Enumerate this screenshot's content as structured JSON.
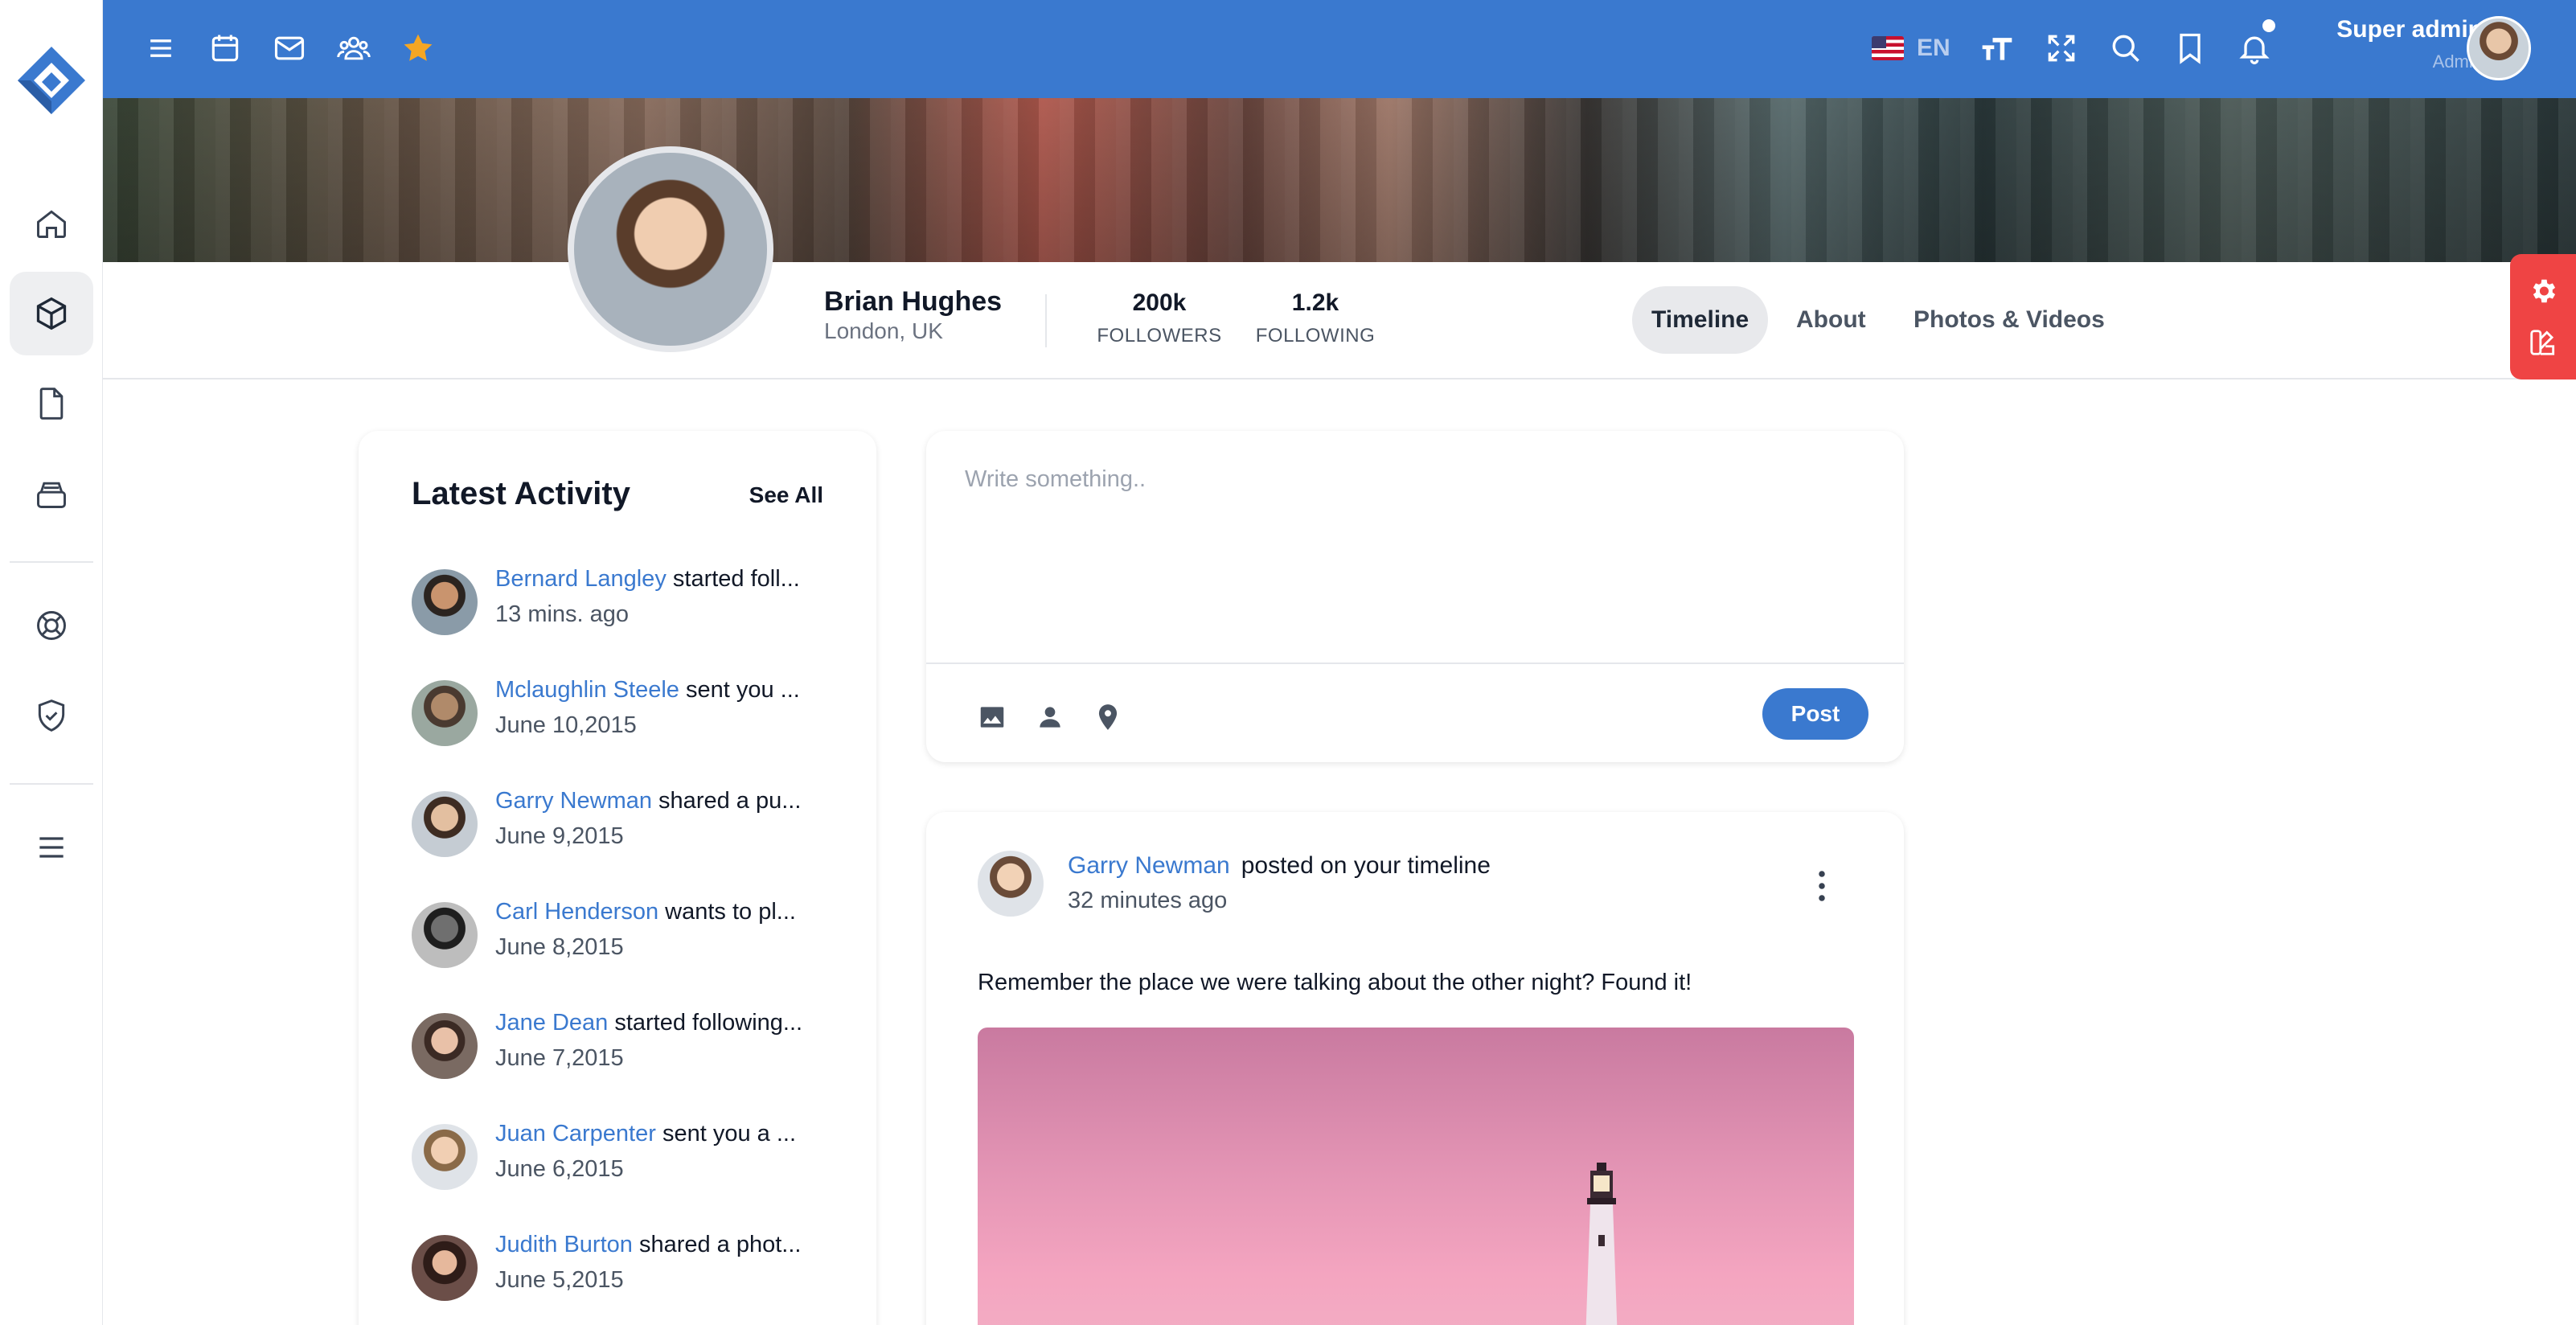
{
  "topbar": {
    "language": "EN",
    "user": {
      "name": "Super admin",
      "role": "Admin"
    }
  },
  "profile": {
    "name": "Brian Hughes",
    "location": "London, UK",
    "stats": [
      {
        "value": "200k",
        "label": "FOLLOWERS"
      },
      {
        "value": "1.2k",
        "label": "FOLLOWING"
      }
    ],
    "tabs": [
      {
        "label": "Timeline",
        "active": true
      },
      {
        "label": "About",
        "active": false
      },
      {
        "label": "Photos & Videos",
        "active": false
      }
    ]
  },
  "activity": {
    "title": "Latest Activity",
    "see_all": "See All",
    "items": [
      {
        "who": "Bernard Langley",
        "action": " started foll...",
        "time": "13 mins. ago"
      },
      {
        "who": "Mclaughlin Steele",
        "action": " sent you ...",
        "time": "June 10,2015"
      },
      {
        "who": "Garry Newman",
        "action": " shared a pu...",
        "time": "June 9,2015"
      },
      {
        "who": "Carl Henderson",
        "action": " wants to pl...",
        "time": "June 8,2015"
      },
      {
        "who": "Jane Dean",
        "action": " started following...",
        "time": "June 7,2015"
      },
      {
        "who": "Juan Carpenter",
        "action": " sent you a ...",
        "time": "June 6,2015"
      },
      {
        "who": "Judith Burton",
        "action": " shared a phot...",
        "time": "June 5,2015"
      }
    ]
  },
  "composer": {
    "placeholder": "Write something..",
    "post_label": "Post"
  },
  "post": {
    "author": "Garry Newman",
    "action": "posted on your timeline",
    "time": "32 minutes ago",
    "text": "Remember the place we were talking about the other night? Found it!"
  },
  "colors": {
    "primary": "#3a79cf",
    "accent_star": "#f5a623",
    "side_tab": "#ef4444"
  },
  "icons": {
    "topbar": [
      "menu-icon",
      "calendar-icon",
      "mail-icon",
      "users-icon",
      "star-icon",
      "text-size-icon",
      "fullscreen-icon",
      "search-icon",
      "bookmark-icon",
      "bell-icon"
    ],
    "rail": [
      "home-icon",
      "cube-icon",
      "file-icon",
      "archive-icon",
      "lifebuoy-icon",
      "shield-check-icon",
      "menu-icon"
    ],
    "composer": [
      "image-icon",
      "person-icon",
      "location-icon"
    ]
  }
}
